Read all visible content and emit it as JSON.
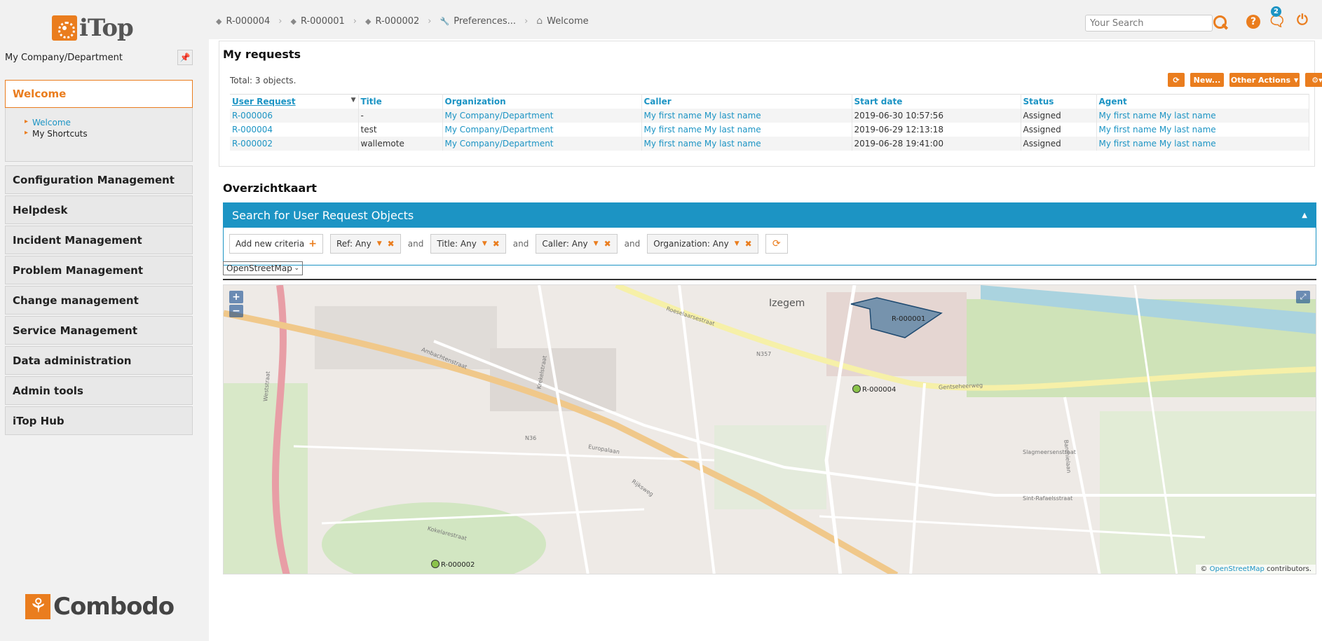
{
  "sidebar": {
    "logo_text": "iTop",
    "org_name": "My Company/Department",
    "welcome_group": {
      "title": "Welcome",
      "items": [
        "Welcome",
        "My Shortcuts"
      ]
    },
    "groups": [
      "Configuration Management",
      "Helpdesk",
      "Incident Management",
      "Problem Management",
      "Change management",
      "Service Management",
      "Data administration",
      "Admin tools",
      "iTop Hub"
    ],
    "footer_logo": "Combodo"
  },
  "topbar": {
    "breadcrumb": [
      "R-000004",
      "R-000001",
      "R-000002",
      "Preferences...",
      "Welcome"
    ],
    "search_placeholder": "Your Search",
    "notification_count": "2"
  },
  "requests": {
    "title": "My requests",
    "total": "Total: 3 objects.",
    "buttons": {
      "new": "New...",
      "other_actions": "Other Actions"
    },
    "columns": [
      "User Request",
      "Title",
      "Organization",
      "Caller",
      "Start date",
      "Status",
      "Agent"
    ],
    "rows": [
      [
        "R-000006",
        "-",
        "My Company/Department",
        "My first name My last name",
        "2019-06-30 10:57:56",
        "Assigned",
        "My first name My last name"
      ],
      [
        "R-000004",
        "test",
        "My Company/Department",
        "My first name My last name",
        "2019-06-29 12:13:18",
        "Assigned",
        "My first name My last name"
      ],
      [
        "R-000002",
        "wallemote",
        "My Company/Department",
        "My first name My last name",
        "2019-06-28 19:41:00",
        "Assigned",
        "My first name My last name"
      ]
    ]
  },
  "map_section": {
    "title": "Overzichtkaart",
    "search_title": "Search for User Request Objects",
    "add_criteria": "Add new criteria",
    "criteria": [
      "Ref: Any",
      "Title: Any",
      "Caller: Any",
      "Organization: Any"
    ],
    "and_label": "and",
    "layer": "OpenStreetMap",
    "markers": [
      "R-000001",
      "R-000004",
      "R-000002"
    ],
    "place_name": "Izegem",
    "streets": [
      "Roeselaarsestraat",
      "Rijksweg",
      "Ambachtenstraat",
      "Gentseheerweg",
      "N357",
      "N36",
      "Weststraat",
      "Krekelstraat",
      "Baronielaan",
      "Kokelarestraat",
      "Europalaan",
      "Slagmeersenstraat",
      "Sint-Rafaelsstraat"
    ],
    "attribution": {
      "prefix": "©",
      "link": "OpenStreetMap",
      "suffix": "contributors."
    },
    "colors": {
      "accent": "#ea7d1e",
      "link": "#1c94c4",
      "marker": "#8bc34a",
      "polygon": "#3b6e99"
    }
  }
}
